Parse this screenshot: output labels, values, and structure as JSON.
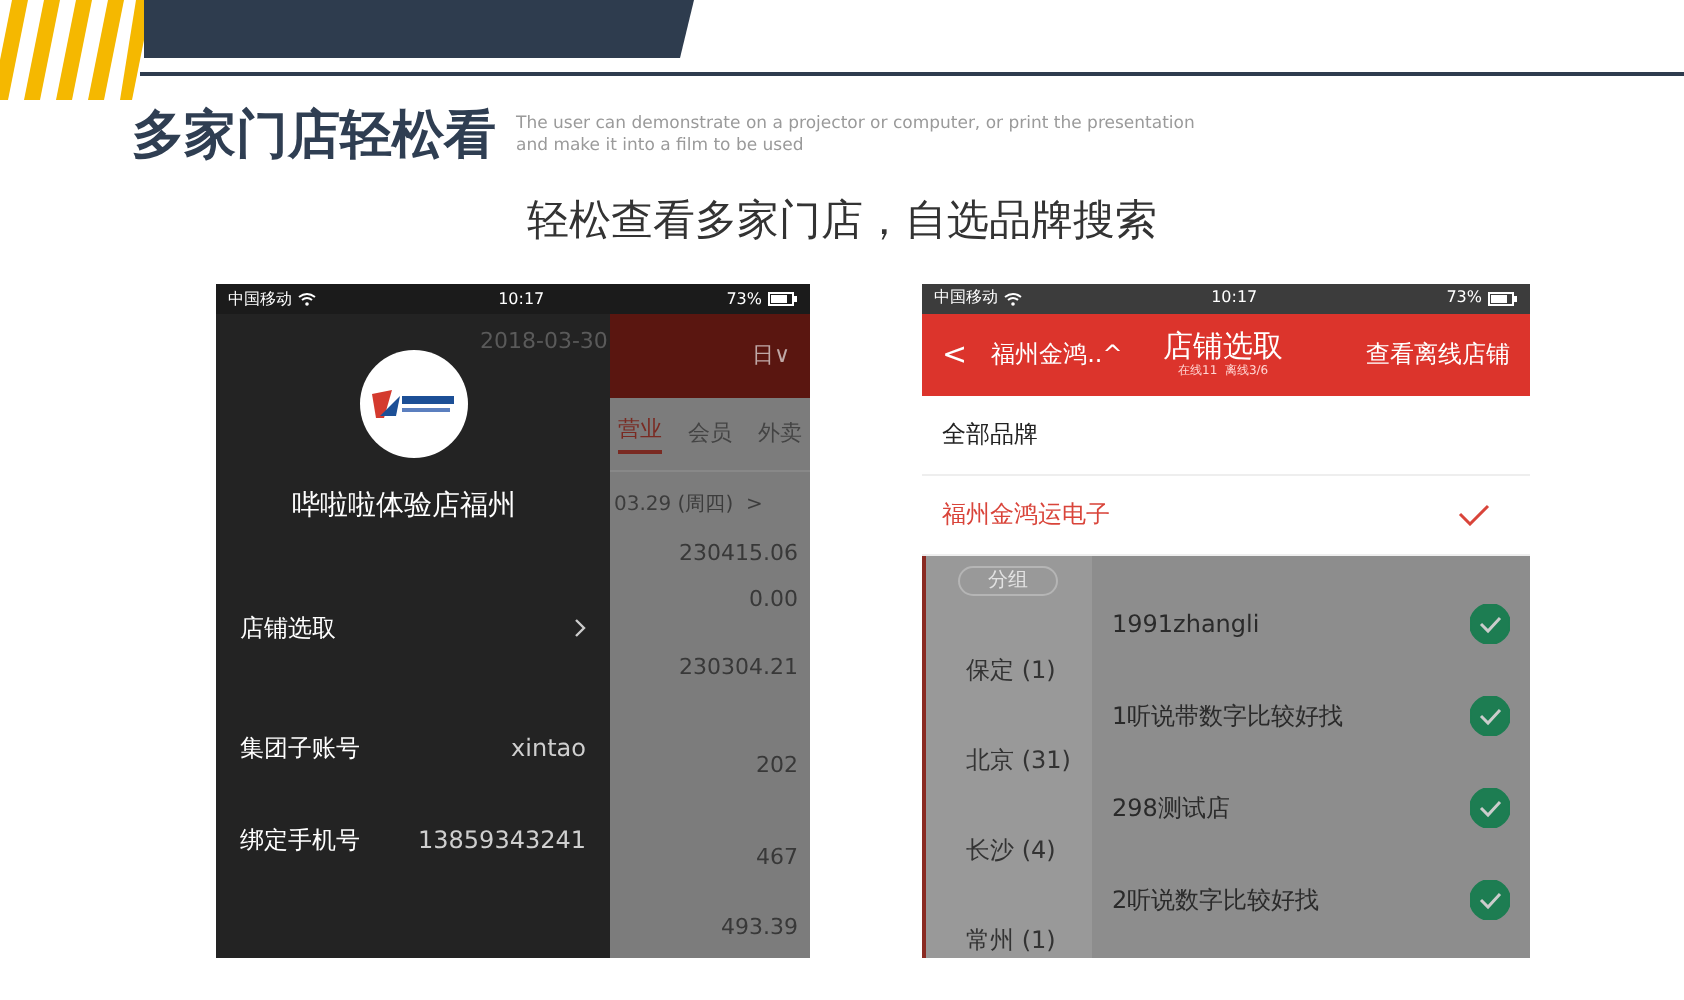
{
  "slide": {
    "title": "多家门店轻松看",
    "caption": [
      "The user can demonstrate on a projector or computer, or print the presentation",
      "and make it into a film to be used"
    ],
    "subtitle": "轻松查看多家门店，自选品牌搜索"
  },
  "left_phone": {
    "status_bar": {
      "carrier": "中国移动",
      "time": "10:17",
      "battery": "73%"
    },
    "header": {
      "date": "2018-03-30",
      "period": "日∨"
    },
    "tabs": [
      {
        "label": "营业",
        "selected": true
      },
      {
        "label": "会员",
        "selected": false
      },
      {
        "label": "外卖",
        "selected": false
      }
    ],
    "date_nav": "03.29 (周四)  >",
    "values": [
      "230415.06",
      "0.00",
      "230304.21",
      "202",
      "467",
      "493.39"
    ],
    "drawer": {
      "store_name": "哔啦啦体验店福州",
      "items": [
        {
          "kind": "link",
          "label": "店铺选取"
        },
        {
          "kind": "info",
          "label": "集团子账号",
          "value": "xintao"
        },
        {
          "kind": "info",
          "label": "绑定手机号",
          "value": "13859343241"
        }
      ]
    }
  },
  "right_phone": {
    "status_bar": {
      "carrier": "中国移动",
      "time": "10:17",
      "battery": "73%"
    },
    "header": {
      "back": "<",
      "brand": "福州金鸿..^",
      "title": "店铺选取",
      "subtitle": "在线11  离线3/6",
      "action": "查看离线店铺"
    },
    "brands": [
      {
        "label": "全部品牌",
        "selected": false
      },
      {
        "label": "福州金鸿运电子",
        "selected": true
      }
    ],
    "group_label": "分组",
    "cities": [
      "保定 (1)",
      "北京 (31)",
      "长沙 (4)",
      "常州 (1)"
    ],
    "stores": [
      {
        "name": "1991zhangli",
        "checked": true
      },
      {
        "name": "1听说带数字比较好找",
        "checked": true
      },
      {
        "name": "298测试店",
        "checked": true
      },
      {
        "name": "2听说数字比较好找",
        "checked": true
      }
    ]
  }
}
